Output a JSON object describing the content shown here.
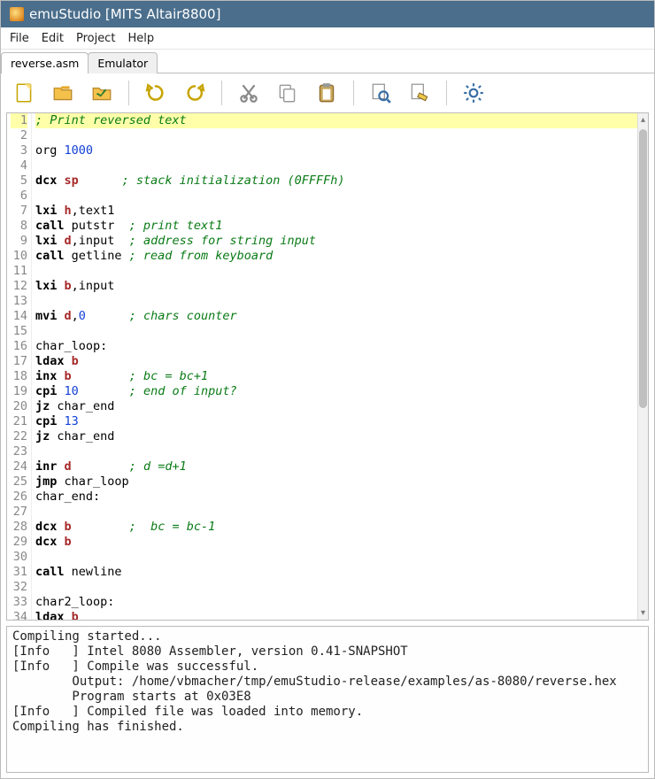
{
  "window": {
    "title": "emuStudio [MITS Altair8800]"
  },
  "menu": {
    "items": [
      "File",
      "Edit",
      "Project",
      "Help"
    ]
  },
  "tabs": [
    {
      "label": "reverse.asm",
      "active": true
    },
    {
      "label": "Emulator",
      "active": false
    }
  ],
  "toolbar": {
    "icons": [
      "new-file-icon",
      "open-folder-icon",
      "save-icon",
      "sep",
      "undo-icon",
      "redo-icon",
      "sep",
      "cut-icon",
      "copy-icon",
      "paste-icon",
      "sep",
      "find-icon",
      "compile-icon",
      "sep",
      "settings-icon"
    ]
  },
  "editor": {
    "highlight_line": 1,
    "lines": [
      {
        "n": 1,
        "spans": [
          [
            "comment",
            "; Print reversed text"
          ]
        ]
      },
      {
        "n": 2,
        "spans": [
          [
            "plain",
            ""
          ]
        ]
      },
      {
        "n": 3,
        "spans": [
          [
            "plain",
            "org "
          ],
          [
            "num",
            "1000"
          ]
        ]
      },
      {
        "n": 4,
        "spans": [
          [
            "plain",
            ""
          ]
        ]
      },
      {
        "n": 5,
        "spans": [
          [
            "key",
            "dcx "
          ],
          [
            "reg",
            "sp"
          ],
          [
            "plain",
            "      "
          ],
          [
            "comment",
            "; stack initialization (0FFFFh)"
          ]
        ]
      },
      {
        "n": 6,
        "spans": [
          [
            "plain",
            ""
          ]
        ]
      },
      {
        "n": 7,
        "spans": [
          [
            "key",
            "lxi "
          ],
          [
            "reg",
            "h"
          ],
          [
            "plain",
            ",text1"
          ]
        ]
      },
      {
        "n": 8,
        "spans": [
          [
            "key",
            "call"
          ],
          [
            "plain",
            " putstr  "
          ],
          [
            "comment",
            "; print text1"
          ]
        ]
      },
      {
        "n": 9,
        "spans": [
          [
            "key",
            "lxi "
          ],
          [
            "reg",
            "d"
          ],
          [
            "plain",
            ",input  "
          ],
          [
            "comment",
            "; address for string input"
          ]
        ]
      },
      {
        "n": 10,
        "spans": [
          [
            "key",
            "call"
          ],
          [
            "plain",
            " getline "
          ],
          [
            "comment",
            "; read from keyboard"
          ]
        ]
      },
      {
        "n": 11,
        "spans": [
          [
            "plain",
            ""
          ]
        ]
      },
      {
        "n": 12,
        "spans": [
          [
            "key",
            "lxi "
          ],
          [
            "reg",
            "b"
          ],
          [
            "plain",
            ",input"
          ]
        ]
      },
      {
        "n": 13,
        "spans": [
          [
            "plain",
            ""
          ]
        ]
      },
      {
        "n": 14,
        "spans": [
          [
            "key",
            "mvi "
          ],
          [
            "reg",
            "d"
          ],
          [
            "plain",
            ","
          ],
          [
            "num",
            "0"
          ],
          [
            "plain",
            "      "
          ],
          [
            "comment",
            "; chars counter"
          ]
        ]
      },
      {
        "n": 15,
        "spans": [
          [
            "plain",
            ""
          ]
        ]
      },
      {
        "n": 16,
        "spans": [
          [
            "plain",
            "char_loop:"
          ]
        ]
      },
      {
        "n": 17,
        "spans": [
          [
            "key",
            "ldax "
          ],
          [
            "reg",
            "b"
          ]
        ]
      },
      {
        "n": 18,
        "spans": [
          [
            "key",
            "inx "
          ],
          [
            "reg",
            "b"
          ],
          [
            "plain",
            "        "
          ],
          [
            "comment",
            "; bc = bc+1"
          ]
        ]
      },
      {
        "n": 19,
        "spans": [
          [
            "key",
            "cpi "
          ],
          [
            "num",
            "10"
          ],
          [
            "plain",
            "       "
          ],
          [
            "comment",
            "; end of input?"
          ]
        ]
      },
      {
        "n": 20,
        "spans": [
          [
            "key",
            "jz"
          ],
          [
            "plain",
            " char_end"
          ]
        ]
      },
      {
        "n": 21,
        "spans": [
          [
            "key",
            "cpi "
          ],
          [
            "num",
            "13"
          ]
        ]
      },
      {
        "n": 22,
        "spans": [
          [
            "key",
            "jz"
          ],
          [
            "plain",
            " char_end"
          ]
        ]
      },
      {
        "n": 23,
        "spans": [
          [
            "plain",
            ""
          ]
        ]
      },
      {
        "n": 24,
        "spans": [
          [
            "key",
            "inr "
          ],
          [
            "reg",
            "d"
          ],
          [
            "plain",
            "        "
          ],
          [
            "comment",
            "; d =d+1"
          ]
        ]
      },
      {
        "n": 25,
        "spans": [
          [
            "key",
            "jmp"
          ],
          [
            "plain",
            " char_loop"
          ]
        ]
      },
      {
        "n": 26,
        "spans": [
          [
            "plain",
            "char_end:"
          ]
        ]
      },
      {
        "n": 27,
        "spans": [
          [
            "plain",
            ""
          ]
        ]
      },
      {
        "n": 28,
        "spans": [
          [
            "key",
            "dcx "
          ],
          [
            "reg",
            "b"
          ],
          [
            "plain",
            "        "
          ],
          [
            "comment",
            ";  bc = bc-1"
          ]
        ]
      },
      {
        "n": 29,
        "spans": [
          [
            "key",
            "dcx "
          ],
          [
            "reg",
            "b"
          ]
        ]
      },
      {
        "n": 30,
        "spans": [
          [
            "plain",
            ""
          ]
        ]
      },
      {
        "n": 31,
        "spans": [
          [
            "key",
            "call"
          ],
          [
            "plain",
            " newline"
          ]
        ]
      },
      {
        "n": 32,
        "spans": [
          [
            "plain",
            ""
          ]
        ]
      },
      {
        "n": 33,
        "spans": [
          [
            "plain",
            "char2_loop:"
          ]
        ]
      },
      {
        "n": 34,
        "spans": [
          [
            "key",
            "ldax "
          ],
          [
            "reg",
            "b"
          ]
        ]
      }
    ]
  },
  "output_lines": [
    "Compiling started...",
    "[Info   ] Intel 8080 Assembler, version 0.41-SNAPSHOT",
    "[Info   ] Compile was successful.",
    "        Output: /home/vbmacher/tmp/emuStudio-release/examples/as-8080/reverse.hex",
    "        Program starts at 0x03E8",
    "[Info   ] Compiled file was loaded into memory.",
    "Compiling has finished."
  ]
}
